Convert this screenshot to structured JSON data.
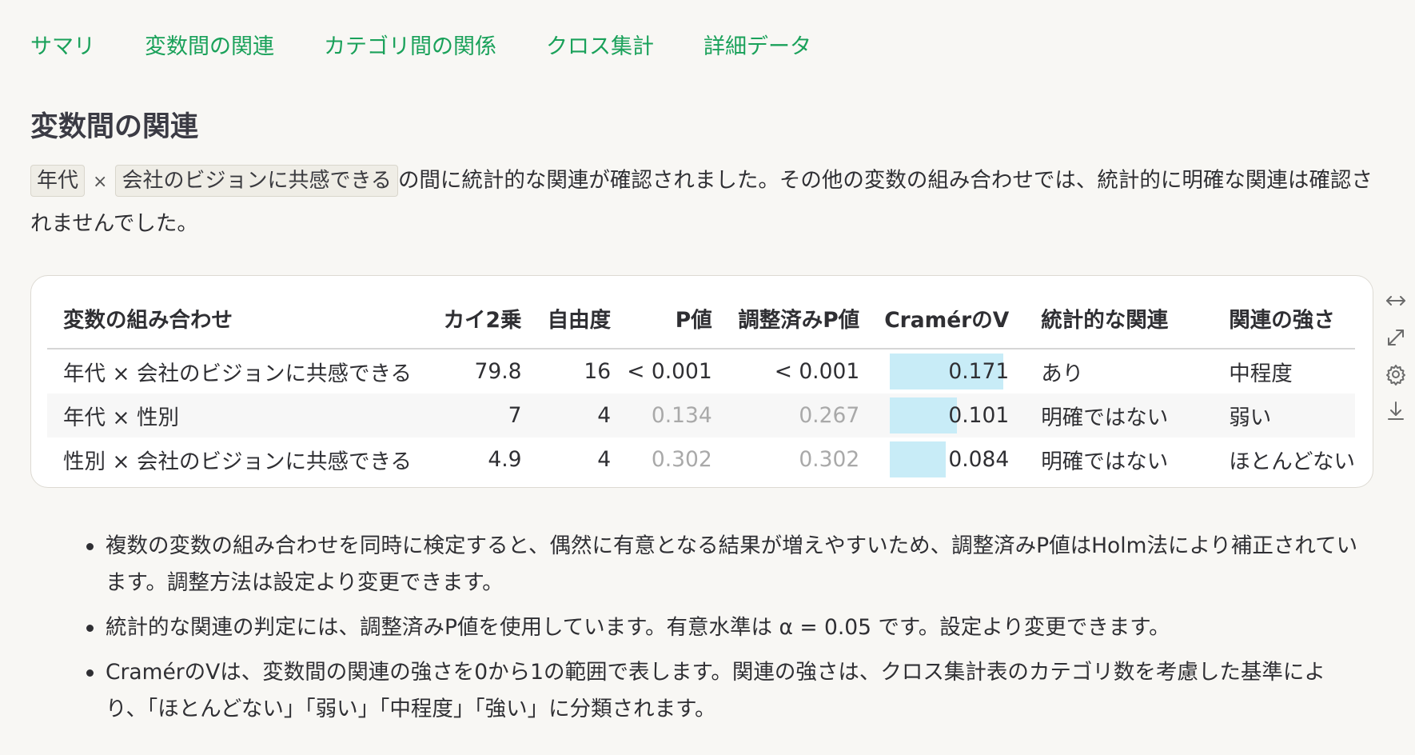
{
  "tabs": [
    "サマリ",
    "変数間の関連",
    "カテゴリ間の関係",
    "クロス集計",
    "詳細データ"
  ],
  "section_title": "変数間の関連",
  "summary": {
    "chip_a": "年代",
    "times": "×",
    "chip_b": "会社のビジョンに共感できる",
    "text": "の間に統計的な関連が確認されました。その他の変数の組み合わせでは、統計的に明確な関連は確認されませんでした。"
  },
  "table": {
    "headers": [
      "変数の組み合わせ",
      "カイ2乗",
      "自由度",
      "P値",
      "調整済みP値",
      "CramérのV",
      "統計的な関連",
      "関連の強さ"
    ],
    "rows": [
      {
        "pair": "年代 × 会社のビジョンに共感できる",
        "chi2": "79.8",
        "df": "16",
        "p": "< 0.001",
        "p_adj": "< 0.001",
        "v": "0.171",
        "v_value": 0.171,
        "sig": "あり",
        "strength": "中程度",
        "p_muted": false
      },
      {
        "pair": "年代 × 性別",
        "chi2": "7",
        "df": "4",
        "p": "0.134",
        "p_adj": "0.267",
        "v": "0.101",
        "v_value": 0.101,
        "sig": "明確ではない",
        "strength": "弱い",
        "p_muted": true
      },
      {
        "pair": "性別 × 会社のビジョンに共感できる",
        "chi2": "4.9",
        "df": "4",
        "p": "0.302",
        "p_adj": "0.302",
        "v": "0.084",
        "v_value": 0.084,
        "sig": "明確ではない",
        "strength": "ほとんどない",
        "p_muted": true
      }
    ],
    "v_bar_color": "#c8ecf7"
  },
  "side_icons": [
    "expand-width-icon",
    "fullscreen-icon",
    "settings-gear-icon",
    "download-icon"
  ],
  "notes": [
    "複数の変数の組み合わせを同時に検定すると、偶然に有意となる結果が増えやすいため、調整済みP値はHolm法により補正されています。調整方法は設定より変更できます。",
    "統計的な関連の判定には、調整済みP値を使用しています。有意水準は α = 0.05 です。設定より変更できます。",
    "CramérのVは、変数間の関連の強さを0から1の範囲で表します。関連の強さは、クロス集計表のカテゴリ数を考慮した基準により、「ほとんどない」「弱い」「中程度」「強い」に分類されます。"
  ],
  "colors": {
    "accent": "#1aa15a",
    "text": "#2f2f33",
    "muted": "#a9a9a9"
  }
}
